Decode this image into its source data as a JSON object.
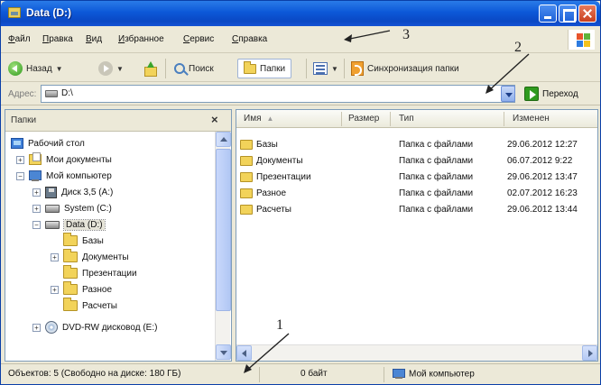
{
  "window": {
    "title": "Data (D:)"
  },
  "menu": [
    "Файл",
    "Правка",
    "Вид",
    "Избранное",
    "Сервис",
    "Справка"
  ],
  "toolbar": {
    "back_label": "Назад",
    "search_label": "Поиск",
    "folders_label": "Папки",
    "sync_label": "Синхронизация папки"
  },
  "address": {
    "label": "Адрес:",
    "value": "D:\\",
    "go_label": "Переход"
  },
  "folder_pane": {
    "title": "Папки",
    "close_glyph": "×",
    "items": [
      {
        "label": "Рабочий стол"
      },
      {
        "label": "Мои документы",
        "expander": "+"
      },
      {
        "label": "Мой компьютер",
        "expander": "−"
      },
      {
        "label": "Диск 3,5 (A:)",
        "expander": "+"
      },
      {
        "label": "System (C:)",
        "expander": "+"
      },
      {
        "label": "Data (D:)",
        "expander": "−"
      },
      {
        "label": "Базы"
      },
      {
        "label": "Документы",
        "expander": "+"
      },
      {
        "label": "Презентации"
      },
      {
        "label": "Разное",
        "expander": "+"
      },
      {
        "label": "Расчеты"
      },
      {
        "label": "DVD-RW дисковод (E:)",
        "expander": "+"
      }
    ]
  },
  "file_pane": {
    "columns": {
      "name": "Имя",
      "size": "Размер",
      "type": "Тип",
      "modified": "Изменен"
    },
    "sort_indicator": "▲",
    "rows": [
      {
        "name": "Базы",
        "type": "Папка с файлами",
        "modified": "29.06.2012 12:27"
      },
      {
        "name": "Документы",
        "type": "Папка с файлами",
        "modified": "06.07.2012 9:22"
      },
      {
        "name": "Презентации",
        "type": "Папка с файлами",
        "modified": "29.06.2012 13:47"
      },
      {
        "name": "Разное",
        "type": "Папка с файлами",
        "modified": "02.07.2012 16:23"
      },
      {
        "name": "Расчеты",
        "type": "Папка с файлами",
        "modified": "29.06.2012 13:44"
      }
    ]
  },
  "status": {
    "objects": "Объектов: 5 (Свободно на диске: 180 ГБ)",
    "size": "0 байт",
    "location": "Мой компьютер"
  },
  "annotations": {
    "one": "1",
    "two": "2",
    "three": "3"
  },
  "colors": {
    "title_bar": "#0c58d8",
    "annotation": "#222222",
    "folder": "#f2d35a"
  }
}
